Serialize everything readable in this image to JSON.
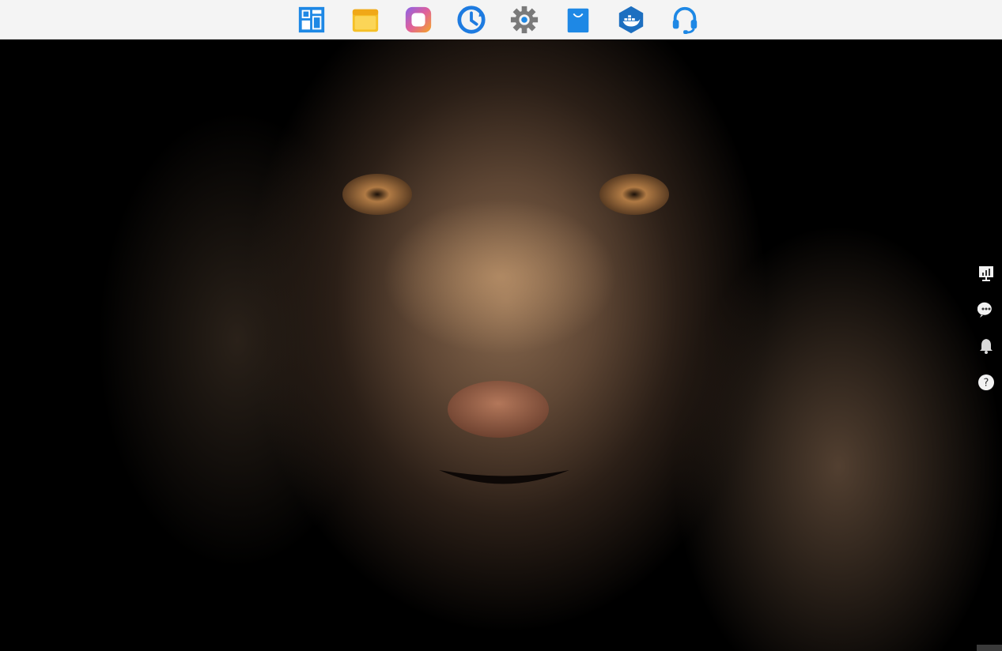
{
  "taskbar": {
    "icons": [
      {
        "name": "control-panel-icon",
        "color": "#1e88e5"
      },
      {
        "name": "file-station-icon",
        "color": "#f5c027"
      },
      {
        "name": "photos-icon",
        "color": "#a06ee0"
      },
      {
        "name": "backup-icon",
        "color": "#1e7be0"
      },
      {
        "name": "settings-icon",
        "color": "#7a7a7a"
      },
      {
        "name": "app-center-icon",
        "color": "#1e88e5"
      },
      {
        "name": "docker-icon",
        "color": "#1d6fc0"
      },
      {
        "name": "support-icon",
        "color": "#1e88e5"
      }
    ]
  },
  "side_tools": [
    {
      "name": "resource-monitor-icon"
    },
    {
      "name": "messages-icon"
    },
    {
      "name": "notifications-icon"
    },
    {
      "name": "help-icon",
      "glyph": "?"
    }
  ],
  "wallpaper": {
    "subject": "lynx",
    "accent": "#8a6a4f"
  }
}
